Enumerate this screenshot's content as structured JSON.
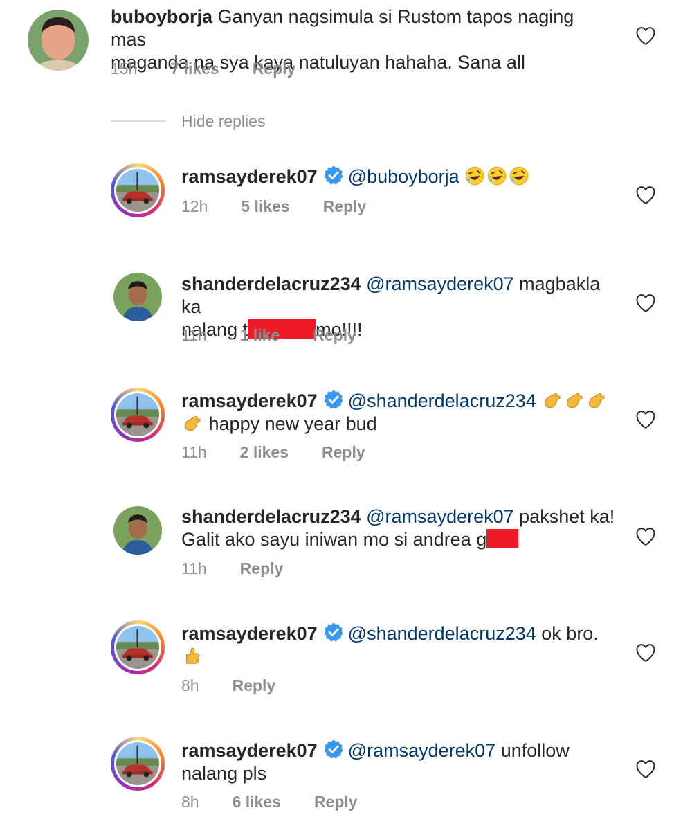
{
  "comment_main": {
    "username": "buboyborja",
    "text_line1": "Ganyan nagsimula si Rustom tapos naging mas",
    "text_line2": "maganda na sya kaya natuluyan hahaha.  Sana all",
    "time": "15h",
    "likes": "7 likes",
    "reply": "Reply"
  },
  "hide_replies": "Hide replies",
  "replies": [
    {
      "username": "ramsayderek07",
      "mention": "@buboyborja",
      "text": "",
      "emojis": "🤣🤣🤣",
      "time": "12h",
      "likes": "5 likes",
      "reply": "Reply"
    },
    {
      "username": "shanderdelacruz234",
      "mention": "@ramsayderek07",
      "text_a": "magbakla ka",
      "text_b1": "nalang t",
      "text_b2": "mo!!!!",
      "time": "11h",
      "likes": "1 like",
      "reply": "Reply"
    },
    {
      "username": "ramsayderek07",
      "mention": "@shanderdelacruz234",
      "emojis": "🤙🤙🤙",
      "emoji_line2": "🤙",
      "text": "happy new year bud",
      "time": "11h",
      "likes": "2 likes",
      "reply": "Reply"
    },
    {
      "username": "shanderdelacruz234",
      "mention": "@ramsayderek07",
      "text_a": "pakshet ka!",
      "text_b": "Galit ako sayu iniwan mo si andrea g",
      "time": "11h",
      "reply": "Reply"
    },
    {
      "username": "ramsayderek07",
      "mention": "@shanderdelacruz234",
      "text_a": "ok bro.",
      "emoji_line2": "👍",
      "time": "8h",
      "reply": "Reply"
    },
    {
      "username": "ramsayderek07",
      "mention": "@ramsayderek07",
      "text_a": "unfollow",
      "text_b": "nalang pls",
      "time": "8h",
      "likes": "6 likes",
      "reply": "Reply"
    }
  ],
  "colors": {
    "mention": "#00376b",
    "meta": "#8e8e8e",
    "verified": "#3897f0",
    "redaction": "#ed1c24"
  },
  "icons": {
    "like": "heart-outline-icon",
    "verified": "verified-badge-icon"
  }
}
